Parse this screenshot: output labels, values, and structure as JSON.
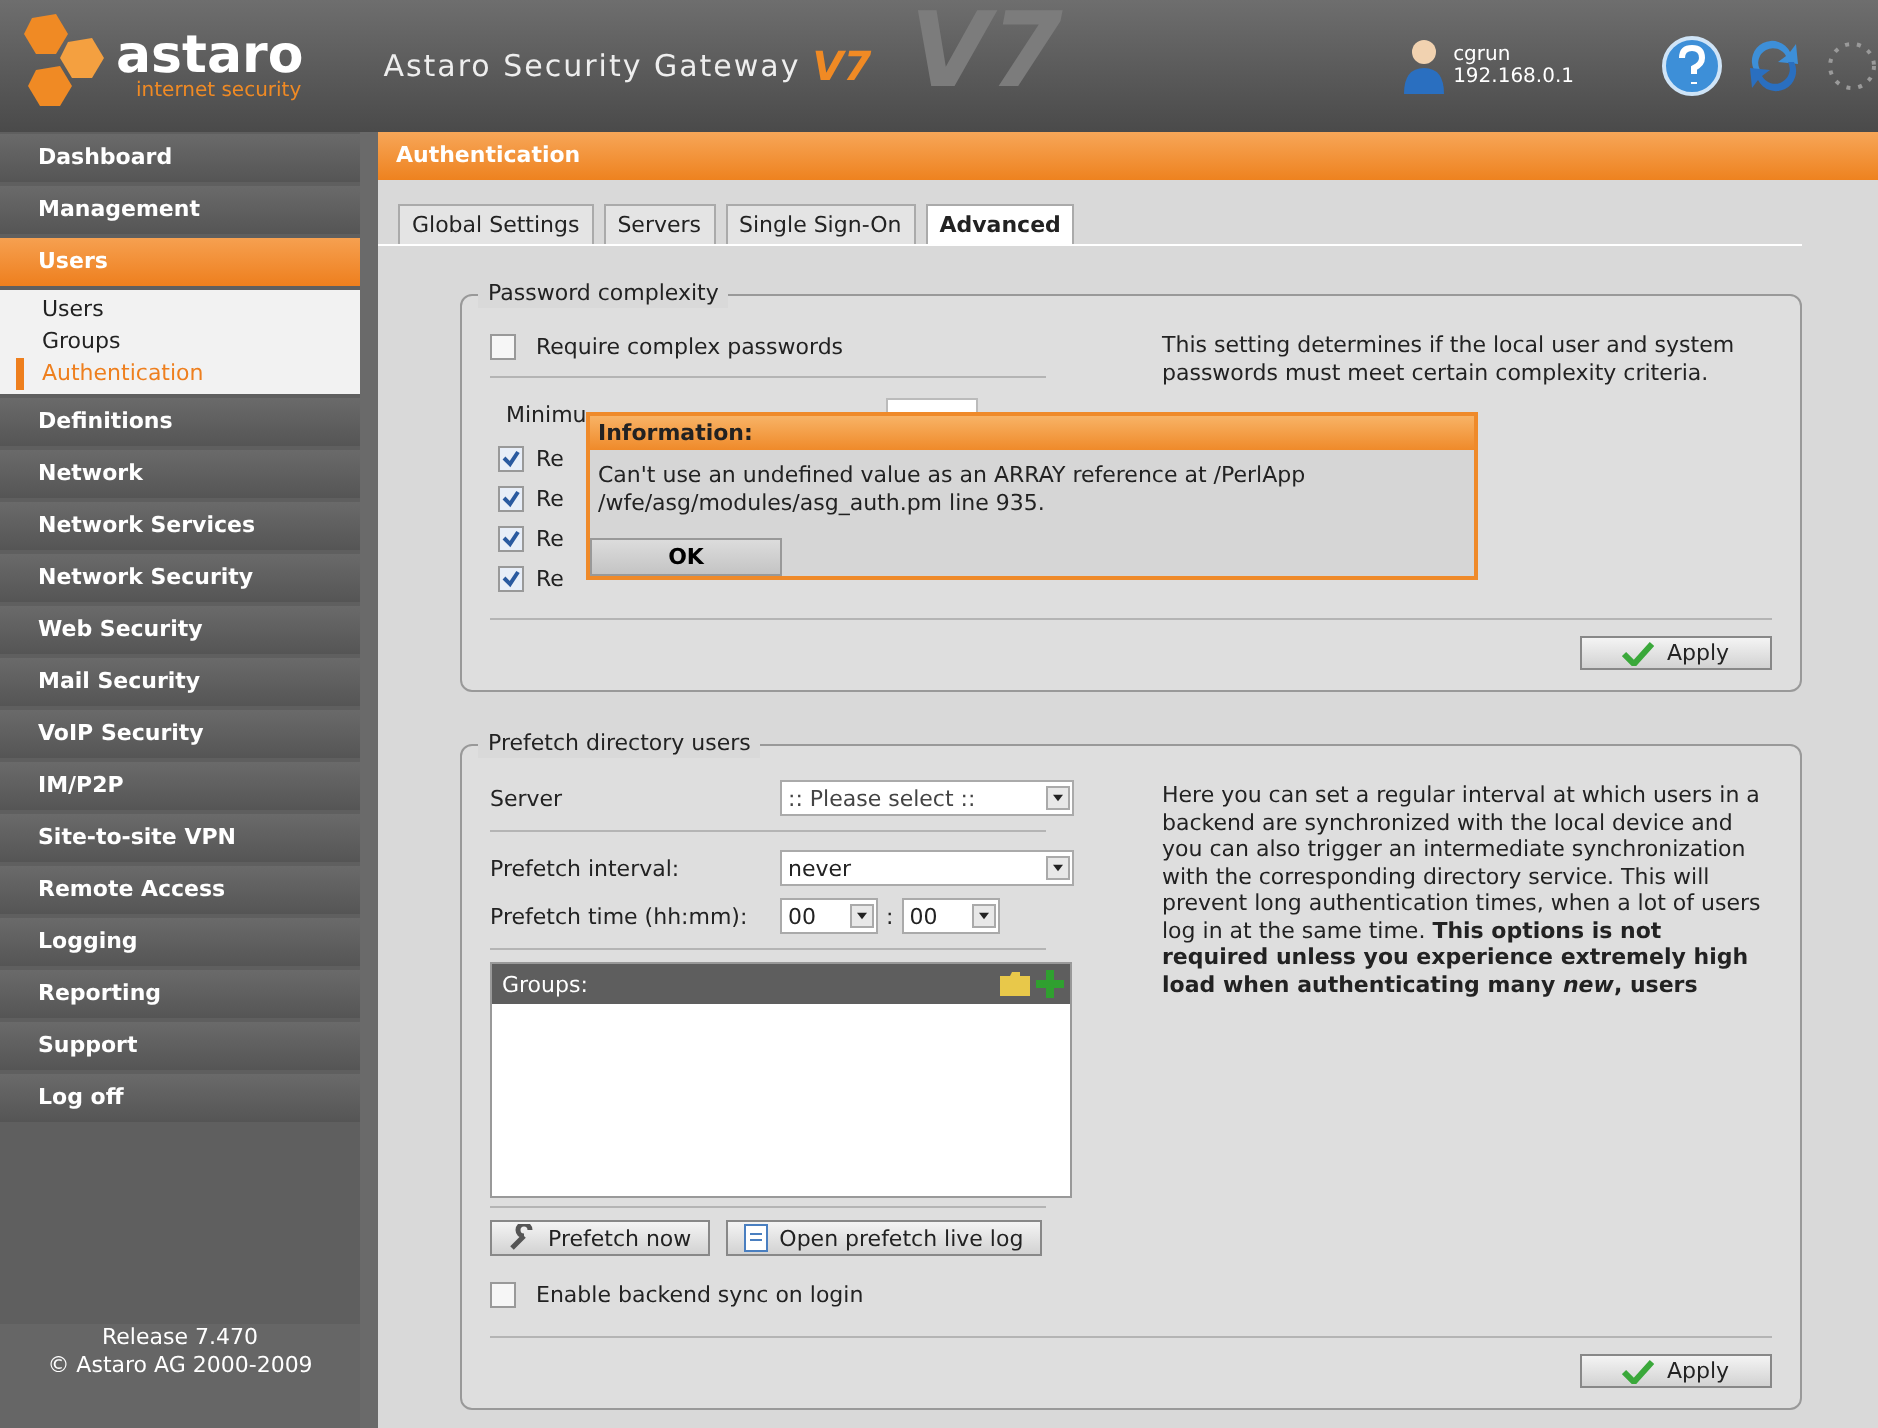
{
  "header": {
    "brand": "astaro",
    "tagline": "internet security",
    "product": "Astaro Security Gateway",
    "version": "V7",
    "backdrop_version": "V7",
    "user": "cgrun",
    "ip": "192.168.0.1"
  },
  "nav": [
    {
      "label": "Dashboard",
      "selected": false
    },
    {
      "label": "Management",
      "selected": false
    },
    {
      "label": "Users",
      "selected": true,
      "children": [
        {
          "label": "Users",
          "selected": false
        },
        {
          "label": "Groups",
          "selected": false
        },
        {
          "label": "Authentication",
          "selected": true
        }
      ]
    },
    {
      "label": "Definitions",
      "selected": false
    },
    {
      "label": "Network",
      "selected": false
    },
    {
      "label": "Network Services",
      "selected": false
    },
    {
      "label": "Network Security",
      "selected": false
    },
    {
      "label": "Web Security",
      "selected": false
    },
    {
      "label": "Mail Security",
      "selected": false
    },
    {
      "label": "VoIP Security",
      "selected": false
    },
    {
      "label": "IM/P2P",
      "selected": false
    },
    {
      "label": "Site-to-site VPN",
      "selected": false
    },
    {
      "label": "Remote Access",
      "selected": false
    },
    {
      "label": "Logging",
      "selected": false
    },
    {
      "label": "Reporting",
      "selected": false
    },
    {
      "label": "Support",
      "selected": false
    },
    {
      "label": "Log off",
      "selected": false
    }
  ],
  "release": "Release 7.470",
  "copyright": "© Astaro AG 2000-2009",
  "page_title": "Authentication",
  "tabs": [
    {
      "label": "Global Settings",
      "selected": false
    },
    {
      "label": "Servers",
      "selected": false
    },
    {
      "label": "Single Sign-On",
      "selected": false
    },
    {
      "label": "Advanced",
      "selected": true
    }
  ],
  "password_complexity": {
    "title": "Password complexity",
    "require_complex": {
      "label": "Require complex passwords",
      "checked": false
    },
    "minimum_label": "Minimu",
    "rules": [
      {
        "label": "Re",
        "checked": true
      },
      {
        "label": "Re",
        "checked": true
      },
      {
        "label": "Re",
        "checked": true
      },
      {
        "label": "Re",
        "checked": true
      }
    ],
    "description": "This setting determines if the local user and system passwords must meet certain complexity criteria.",
    "apply": "Apply"
  },
  "prefetch": {
    "title": "Prefetch directory users",
    "server_label": "Server",
    "server_value": ":: Please select ::",
    "interval_label": "Prefetch interval:",
    "interval_value": "never",
    "time_label": "Prefetch time (hh:mm):",
    "hours": "00",
    "separator": ":",
    "minutes": "00",
    "groups_label": "Groups:",
    "prefetch_now": "Prefetch now",
    "open_log": "Open prefetch live log",
    "sync": {
      "label": "Enable backend sync on login",
      "checked": false
    },
    "description": "Here you can set a regular interval at which users in a backend are synchronized with the local device and you can also trigger an intermediate synchronization with the corresponding directory service. This will prevent long authentication times, when a lot of users log in at the same time. **This options is not required unless you experience extremely high load when authenticating many *new*, users**",
    "apply": "Apply"
  },
  "dialog": {
    "title": "Information:",
    "message": "Can't use an undefined value as an ARRAY reference at /PerlApp /wfe/asg/modules/asg_auth.pm line 935.",
    "ok": "OK"
  }
}
